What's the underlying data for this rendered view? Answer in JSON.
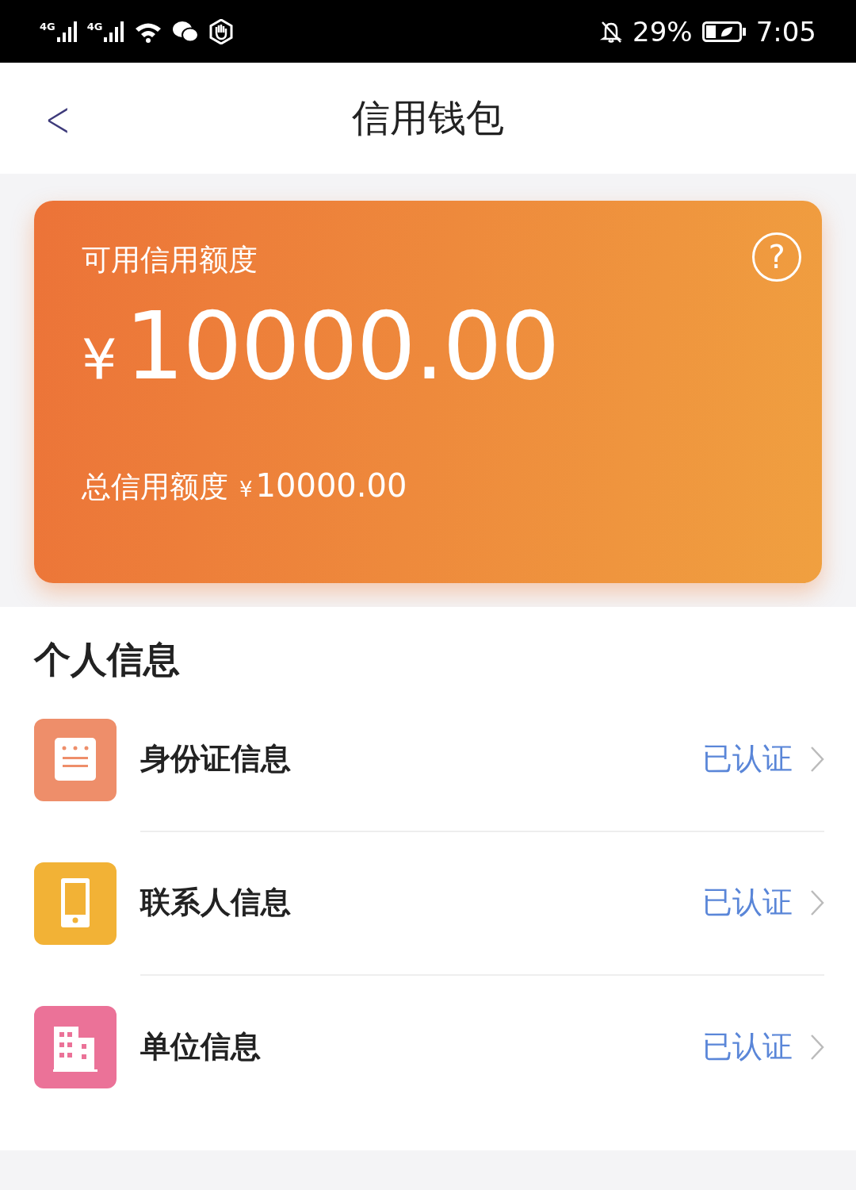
{
  "status_bar": {
    "networks": [
      "4G",
      "4G"
    ],
    "battery": "29%",
    "time": "7:05"
  },
  "header": {
    "back": "<",
    "title": "信用钱包"
  },
  "card": {
    "label": "可用信用额度",
    "currency": "¥",
    "amount": "10000.00",
    "help": "?",
    "total_label": "总信用额度",
    "total_currency": "¥",
    "total_amount": "10000.00"
  },
  "section": {
    "title": "个人信息",
    "items": [
      {
        "kind": "id",
        "color": "#ee8e6a",
        "label": "身份证信息",
        "status": "已认证"
      },
      {
        "kind": "phone",
        "color": "#f2b236",
        "label": "联系人信息",
        "status": "已认证"
      },
      {
        "kind": "building",
        "color": "#eb7298",
        "label": "单位信息",
        "status": "已认证"
      }
    ]
  }
}
